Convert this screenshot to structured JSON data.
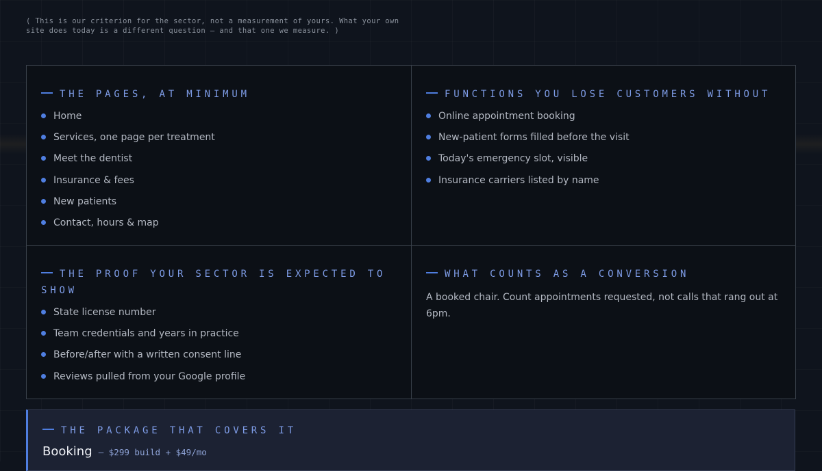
{
  "note": "( This is our criterion for the sector, not a measurement of yours. What your own site does today is a different question — and that one we measure. )",
  "colors": {
    "accent": "#4f7ee0",
    "heading": "#7e9ce6",
    "background": "#0f141d",
    "panel": "#0c1016",
    "package_panel": "#1c2233"
  },
  "sections": {
    "pages": {
      "title": "The pages, at minimum",
      "items": [
        "Home",
        "Services, one page per treatment",
        "Meet the dentist",
        "Insurance & fees",
        "New patients",
        "Contact, hours & map"
      ]
    },
    "functions": {
      "title": "Functions you lose customers without",
      "items": [
        "Online appointment booking",
        "New-patient forms filled before the visit",
        "Today's emergency slot, visible",
        "Insurance carriers listed by name"
      ]
    },
    "proof": {
      "title": "The proof your sector is expected to show",
      "items": [
        "State license number",
        "Team credentials and years in practice",
        "Before/after with a written consent line",
        "Reviews pulled from your Google profile"
      ]
    },
    "conversion": {
      "title": "What counts as a conversion",
      "text": "A booked chair. Count appointments requested, not calls that rang out at 6pm."
    }
  },
  "package": {
    "title": "The package that covers it",
    "name": "Booking",
    "price": "— $299 build + $49/mo"
  }
}
